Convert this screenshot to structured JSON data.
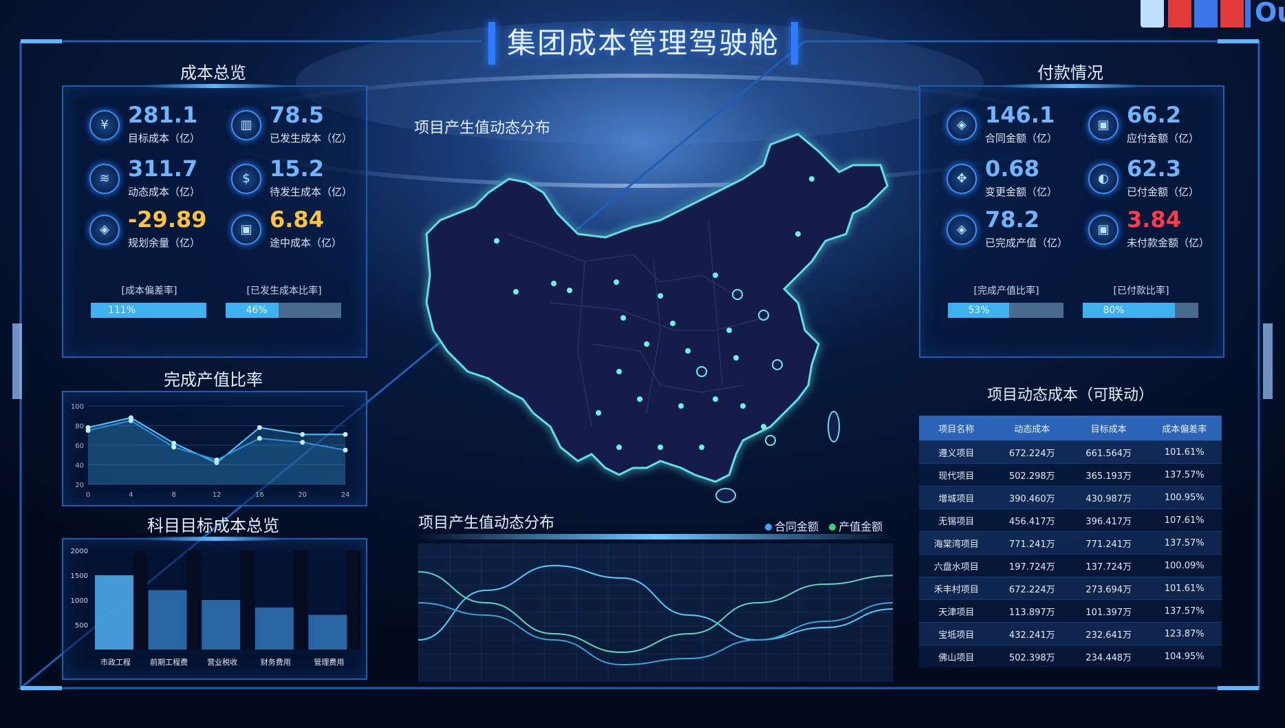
{
  "header": {
    "title": "集团成本管理驾驶舱",
    "corner_text": "Ou"
  },
  "cost_overview": {
    "title": "成本总览",
    "kpis": [
      {
        "value": "281.1",
        "label": "目标成本（亿）",
        "icon": "yen-icon",
        "tone": "normal"
      },
      {
        "value": "78.5",
        "label": "已发生成本（亿）",
        "icon": "chart-icon",
        "tone": "normal"
      },
      {
        "value": "311.7",
        "label": "动态成本（亿）",
        "icon": "coins-icon",
        "tone": "normal"
      },
      {
        "value": "15.2",
        "label": "待发生成本（亿）",
        "icon": "money-bag-icon",
        "tone": "normal"
      },
      {
        "value": "-29.89",
        "label": "规划余量（亿）",
        "icon": "cube-icon",
        "tone": "warn"
      },
      {
        "value": "6.84",
        "label": "途中成本（亿）",
        "icon": "box-icon",
        "tone": "warn"
      }
    ],
    "ratios": [
      {
        "label": "[成本偏差率]",
        "text": "111%",
        "value": 1.0
      },
      {
        "label": "[已发生成本比率]",
        "text": "46%",
        "value": 0.46
      }
    ]
  },
  "payment": {
    "title": "付款情况",
    "kpis": [
      {
        "value": "146.1",
        "label": "合同金额（亿）",
        "icon": "cube-icon",
        "tone": "normal"
      },
      {
        "value": "66.2",
        "label": "应付金额（亿）",
        "icon": "box-icon",
        "tone": "normal"
      },
      {
        "value": "0.68",
        "label": "变更金额（亿）",
        "icon": "target-icon",
        "tone": "normal"
      },
      {
        "value": "62.3",
        "label": "已付金额（亿）",
        "icon": "pie-icon",
        "tone": "normal"
      },
      {
        "value": "78.2",
        "label": "已完成产值（亿）",
        "icon": "cube-icon",
        "tone": "normal"
      },
      {
        "value": "3.84",
        "label": "未付款金额（亿）",
        "icon": "box-icon",
        "tone": "red"
      }
    ],
    "ratios": [
      {
        "label": "[完成产值比率]",
        "text": "53%",
        "value": 0.53
      },
      {
        "label": "[已付款比率]",
        "text": "80%",
        "value": 0.8
      }
    ]
  },
  "output_ratio": {
    "title": "完成产值比率"
  },
  "subject_cost": {
    "title": "科目目标成本总览"
  },
  "map": {
    "title": "项目产生值动态分布",
    "legend": [
      {
        "label": "合同金额",
        "color": "#3aa6ff"
      },
      {
        "label": "产值金额",
        "color": "#35d27a"
      }
    ]
  },
  "wave": {
    "title": "项目产生值动态分布"
  },
  "project_table": {
    "title": "项目动态成本（可联动）",
    "columns": [
      "项目名称",
      "动态成本",
      "目标成本",
      "成本偏差率"
    ],
    "rows": [
      [
        "遵义项目",
        "672.224万",
        "661.564万",
        "101.61%"
      ],
      [
        "现代项目",
        "502.298万",
        "365.193万",
        "137.57%"
      ],
      [
        "增城项目",
        "390.460万",
        "430.987万",
        "100.95%"
      ],
      [
        "无锡项目",
        "456.417万",
        "396.417万",
        "107.61%"
      ],
      [
        "海棠湾项目",
        "771.241万",
        "771.241万",
        "137.57%"
      ],
      [
        "六盘水项目",
        "197.724万",
        "137.724万",
        "100.09%"
      ],
      [
        "禾丰村项目",
        "672.224万",
        "273.694万",
        "101.61%"
      ],
      [
        "天津项目",
        "113.897万",
        "101.397万",
        "137.57%"
      ],
      [
        "宝坻项目",
        "432.241万",
        "232.641万",
        "123.87%"
      ],
      [
        "佛山项目",
        "502.398万",
        "234.448万",
        "104.95%"
      ]
    ]
  },
  "chart_data": [
    {
      "type": "line",
      "title": "完成产值比率",
      "x": [
        0,
        4,
        8,
        12,
        16,
        20,
        24
      ],
      "yticks": [
        20,
        40,
        60,
        80,
        100
      ],
      "xlim": [
        0,
        24
      ],
      "ylim": [
        20,
        100
      ],
      "series": [
        {
          "values": [
            78,
            88,
            62,
            42,
            78,
            71,
            71
          ],
          "color": "#4ec7ff"
        },
        {
          "values": [
            75,
            85,
            58,
            45,
            67,
            63,
            55
          ],
          "color": "#2f8fdf"
        }
      ]
    },
    {
      "type": "bar",
      "title": "科目目标成本总览",
      "categories": [
        "市政工程",
        "前期工程费",
        "营业税收",
        "财务费用",
        "管理费用"
      ],
      "values": [
        1500,
        1200,
        1000,
        850,
        700
      ],
      "background_values": [
        2000,
        2000,
        2000,
        2000,
        2000
      ],
      "yticks": [
        500,
        1000,
        1500,
        2000
      ],
      "ylim": [
        0,
        2000
      ]
    },
    {
      "type": "line",
      "title": "项目产生值动态分布",
      "series": [
        {
          "values": [
            0.3,
            0.7,
            0.9,
            0.8,
            0.5,
            0.3,
            0.4,
            0.55
          ],
          "color": "#4fd0ff"
        },
        {
          "values": [
            0.85,
            0.6,
            0.35,
            0.2,
            0.35,
            0.6,
            0.75,
            0.82
          ],
          "color": "#5fd6c0"
        },
        {
          "values": [
            0.6,
            0.5,
            0.3,
            0.1,
            0.15,
            0.3,
            0.45,
            0.6
          ],
          "color": "#38a6d8"
        }
      ]
    }
  ]
}
